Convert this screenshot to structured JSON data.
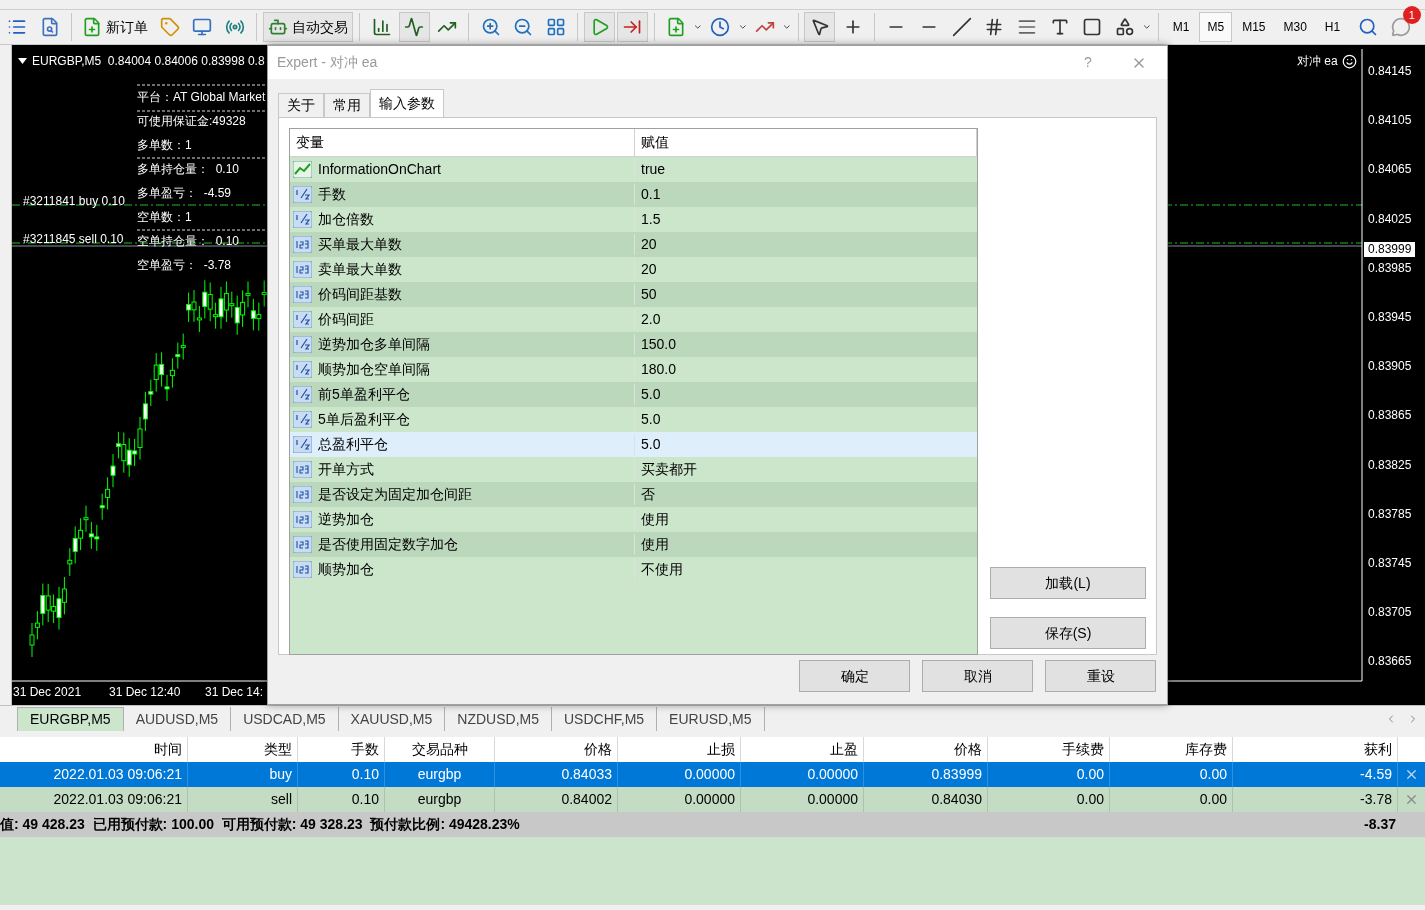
{
  "toolbar": {
    "new_order": "新订单",
    "auto_trading": "自动交易",
    "timeframes": [
      {
        "label": "M1",
        "selected": false
      },
      {
        "label": "M5",
        "selected": true
      },
      {
        "label": "M15",
        "selected": false
      },
      {
        "label": "M30",
        "selected": false
      },
      {
        "label": "H1",
        "selected": false
      }
    ],
    "notification_count": "1"
  },
  "chart": {
    "header": "EURGBP,M5  0.84004 0.84006 0.83998 0.8",
    "info_lines": [
      "平台：AT Global Market",
      "可使用保证金:49328",
      "多单数：1",
      "多单持仓量：  0.10",
      "多单盈亏：  -4.59",
      "空单数：1",
      "空单持仓量：  0.10",
      "空单盈亏：  -3.78"
    ],
    "order_labels": [
      "#3211841 buy 0.10",
      "#3211845 sell 0.10"
    ],
    "time_labels": [
      "31 Dec 2021",
      "31 Dec 12:40",
      "31 Dec 14:"
    ],
    "expert_label": "对冲 ea",
    "price_labels": [
      "0.84145",
      "0.84105",
      "0.84065",
      "0.84025",
      "0.83985",
      "0.83945",
      "0.83905",
      "0.83865",
      "0.83825",
      "0.83785",
      "0.83745",
      "0.83705",
      "0.83665"
    ],
    "current_price": "0.83999"
  },
  "dialog": {
    "title": "Expert - 对冲 ea",
    "help": "?",
    "tabs": [
      {
        "label": "关于",
        "selected": false
      },
      {
        "label": "常用",
        "selected": false
      },
      {
        "label": "输入参数",
        "selected": true
      }
    ],
    "table": {
      "columns": [
        "变量",
        "赋值"
      ],
      "rows": [
        {
          "kind": "bool",
          "name": "InformationOnChart",
          "value": "true",
          "selected": false
        },
        {
          "kind": "double",
          "name": "手数",
          "value": "0.1",
          "selected": false
        },
        {
          "kind": "double",
          "name": "加仓倍数",
          "value": "1.5",
          "selected": false
        },
        {
          "kind": "int",
          "name": "买单最大单数",
          "value": "20",
          "selected": false
        },
        {
          "kind": "int",
          "name": "卖单最大单数",
          "value": "20",
          "selected": false
        },
        {
          "kind": "int",
          "name": "价码间距基数",
          "value": "50",
          "selected": false
        },
        {
          "kind": "double",
          "name": "价码间距",
          "value": "2.0",
          "selected": false
        },
        {
          "kind": "double",
          "name": "逆势加仓多单间隔",
          "value": "150.0",
          "selected": false
        },
        {
          "kind": "double",
          "name": "顺势加仓空单间隔",
          "value": "180.0",
          "selected": false
        },
        {
          "kind": "double",
          "name": "前5单盈利平仓",
          "value": "5.0",
          "selected": false
        },
        {
          "kind": "double",
          "name": "5单后盈利平仓",
          "value": "5.0",
          "selected": false
        },
        {
          "kind": "double",
          "name": "总盈利平仓",
          "value": "5.0",
          "selected": true
        },
        {
          "kind": "int",
          "name": "开单方式",
          "value": "买卖都开",
          "selected": false
        },
        {
          "kind": "int",
          "name": "是否设定为固定加仓间距",
          "value": "否",
          "selected": false
        },
        {
          "kind": "int",
          "name": "逆势加仓",
          "value": "使用",
          "selected": false
        },
        {
          "kind": "int",
          "name": "是否使用固定数字加仓",
          "value": "使用",
          "selected": false
        },
        {
          "kind": "int",
          "name": "顺势加仓",
          "value": "不使用",
          "selected": false
        }
      ]
    },
    "side_buttons": [
      "加载(L)",
      "保存(S)"
    ],
    "buttons": [
      "确定",
      "取消",
      "重设"
    ]
  },
  "symbol_tabs": [
    {
      "label": "EURGBP,M5",
      "selected": true
    },
    {
      "label": "AUDUSD,M5",
      "selected": false
    },
    {
      "label": "USDCAD,M5",
      "selected": false
    },
    {
      "label": "XAUUSD,M5",
      "selected": false
    },
    {
      "label": "NZDUSD,M5",
      "selected": false
    },
    {
      "label": "USDCHF,M5",
      "selected": false
    },
    {
      "label": "EURUSD,M5",
      "selected": false
    }
  ],
  "trade_table": {
    "columns": [
      "时间",
      "类型",
      "手数",
      "交易品种",
      "价格",
      "止损",
      "止盈",
      "价格",
      "手续费",
      "库存费",
      "获利"
    ],
    "rows": [
      {
        "cells": [
          "2022.01.03 09:06:21",
          "buy",
          "0.10",
          "eurgbp",
          "0.84033",
          "0.00000",
          "0.00000",
          "0.83999",
          "0.00",
          "0.00",
          "-4.59"
        ],
        "selected": true
      },
      {
        "cells": [
          "2022.01.03 09:06:21",
          "sell",
          "0.10",
          "eurgbp",
          "0.84002",
          "0.00000",
          "0.00000",
          "0.84030",
          "0.00",
          "0.00",
          "-3.78"
        ],
        "selected": false
      }
    ],
    "summary": {
      "text": "值: 49 428.23  已用预付款: 100.00  可用预付款: 49 328.23  预付款比例: 49428.23%",
      "profit": "-8.37"
    }
  }
}
